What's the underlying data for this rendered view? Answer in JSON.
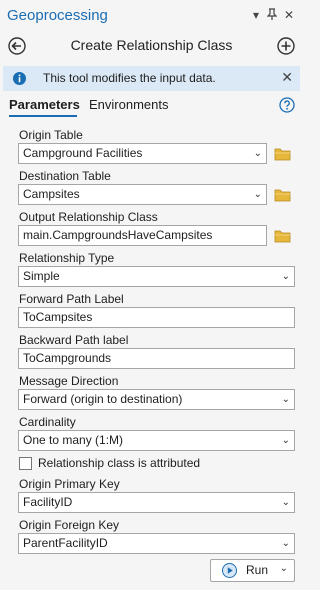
{
  "pane": {
    "title": "Geoprocessing",
    "menu_icon": "chevron-down-icon",
    "pin_icon": "pin-icon",
    "close_icon": "close-icon"
  },
  "tool": {
    "title": "Create Relationship Class",
    "back_icon": "back-arrow-icon",
    "add_icon": "add-icon"
  },
  "info": {
    "message": "This tool modifies the input data.",
    "icon": "info-icon"
  },
  "tabs": {
    "parameters": "Parameters",
    "environments": "Environments",
    "help_icon": "help-icon"
  },
  "params": {
    "origin_table": {
      "label": "Origin Table",
      "value": "Campground Facilities"
    },
    "destination_table": {
      "label": "Destination Table",
      "value": "Campsites"
    },
    "output_relationship_class": {
      "label": "Output Relationship Class",
      "value": "main.CampgroundsHaveCampsites"
    },
    "relationship_type": {
      "label": "Relationship Type",
      "value": "Simple"
    },
    "forward_path_label": {
      "label": "Forward Path Label",
      "value": "ToCampsites"
    },
    "backward_path_label": {
      "label": "Backward Path label",
      "value": "ToCampgrounds"
    },
    "message_direction": {
      "label": "Message Direction",
      "value": "Forward (origin to destination)"
    },
    "cardinality": {
      "label": "Cardinality",
      "value": "One to many (1:M)"
    },
    "attributed": {
      "label": "Relationship class is attributed",
      "checked": false
    },
    "origin_primary_key": {
      "label": "Origin Primary Key",
      "value": "FacilityID"
    },
    "origin_foreign_key": {
      "label": "Origin Foreign Key",
      "value": "ParentFacilityID"
    }
  },
  "run": {
    "label": "Run"
  },
  "colors": {
    "accent": "#1a6db3",
    "info_bg": "#dbe9f6",
    "folder": "#e5b73b"
  }
}
